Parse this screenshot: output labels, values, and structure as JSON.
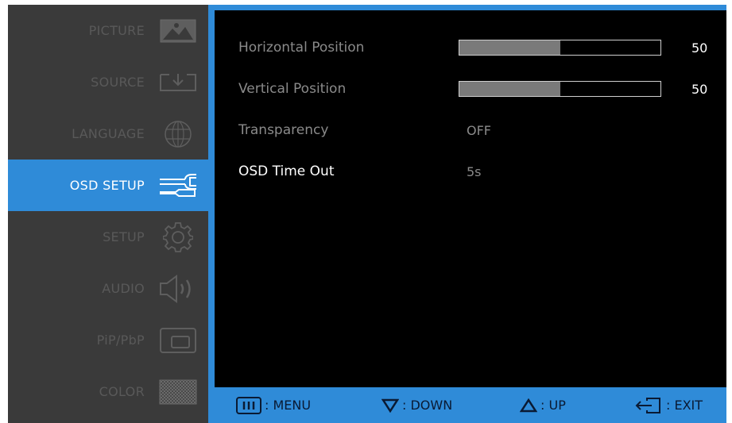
{
  "sidebar": {
    "items": [
      {
        "label": "PICTURE",
        "icon": "picture-icon",
        "active": false
      },
      {
        "label": "SOURCE",
        "icon": "source-input-icon",
        "active": false
      },
      {
        "label": "LANGUAGE",
        "icon": "globe-icon",
        "active": false
      },
      {
        "label": "OSD SETUP",
        "icon": "wrench-icon",
        "active": true
      },
      {
        "label": "SETUP",
        "icon": "gear-icon",
        "active": false
      },
      {
        "label": "AUDIO",
        "icon": "speaker-icon",
        "active": false
      },
      {
        "label": "PiP/PbP",
        "icon": "pip-icon",
        "active": false
      },
      {
        "label": "COLOR",
        "icon": "color-pattern-icon",
        "active": false
      }
    ]
  },
  "settings": [
    {
      "name": "Horizontal Position",
      "type": "slider",
      "value": 50,
      "display": "50",
      "max": 100
    },
    {
      "name": "Vertical Position",
      "type": "slider",
      "value": 50,
      "display": "50",
      "max": 100
    },
    {
      "name": "Transparency",
      "type": "option",
      "value": "OFF"
    },
    {
      "name": "OSD Time Out",
      "type": "option",
      "value": "5s",
      "active": true
    }
  ],
  "footer": {
    "menu": {
      "key": "III",
      "label": ": MENU"
    },
    "down": {
      "label": ": DOWN"
    },
    "up": {
      "label": ": UP"
    },
    "exit": {
      "label": ": EXIT"
    }
  },
  "colors": {
    "accent": "#2f8bd8",
    "sidebar_bg": "#3a3a3a",
    "panel_bg": "#000000",
    "footer_text": "#0a1a33"
  }
}
